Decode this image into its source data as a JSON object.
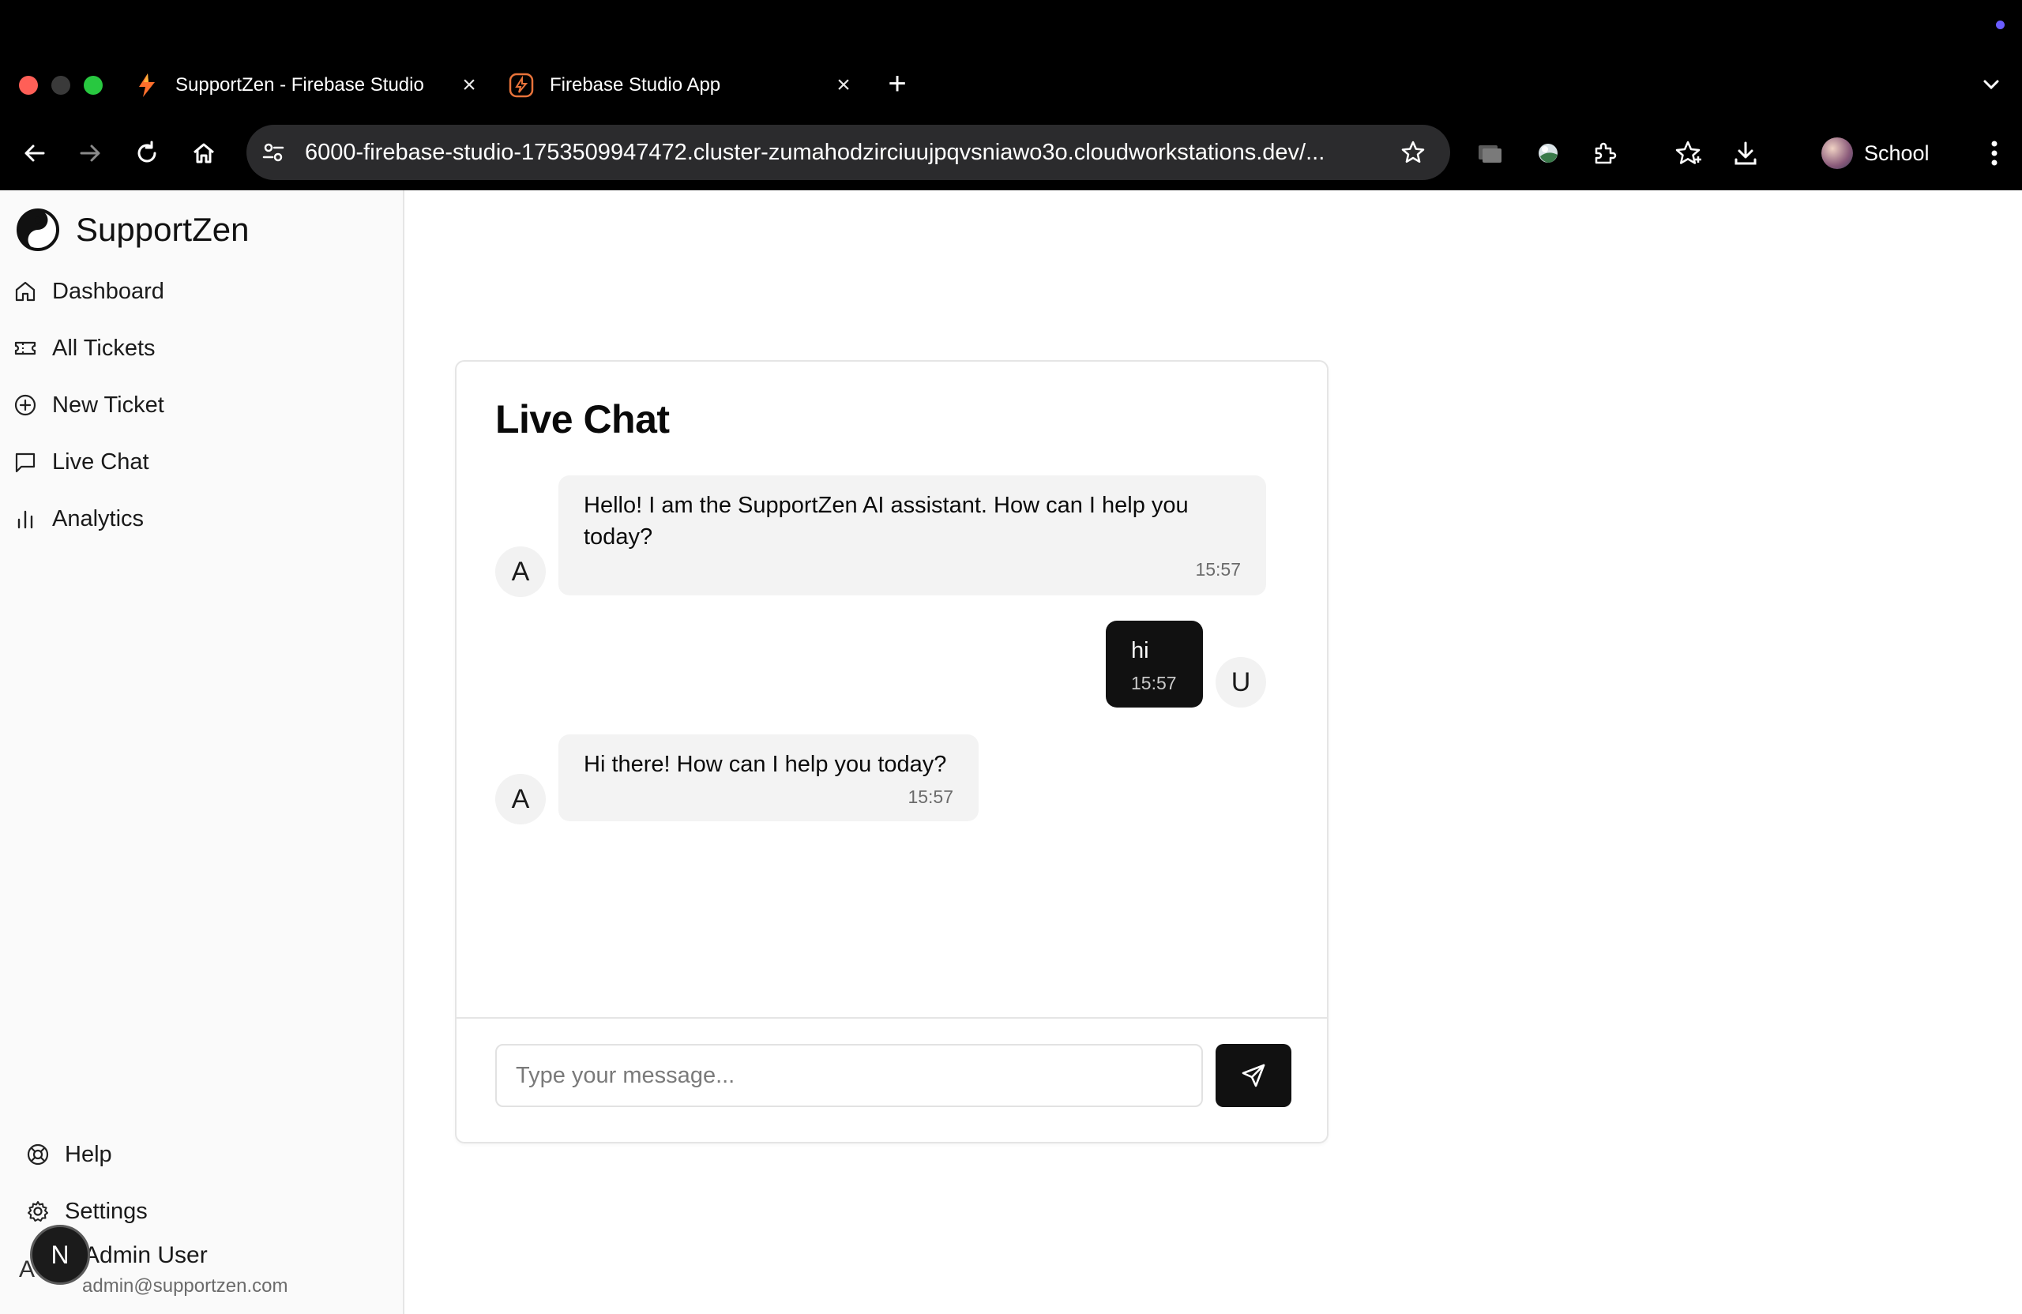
{
  "browser": {
    "tabs": [
      {
        "title": "SupportZen - Firebase Studio",
        "icon": "firebase-flame-icon"
      },
      {
        "title": "Firebase Studio App",
        "icon": "firebase-studio-icon"
      }
    ],
    "url": "6000-firebase-studio-1753509947472.cluster-zumahodzirciuujpqvsniawo3o.cloudworkstations.dev/...",
    "profile_label": "School"
  },
  "sidebar": {
    "brand": "SupportZen",
    "items": [
      {
        "label": "Dashboard",
        "icon": "home-icon"
      },
      {
        "label": "All Tickets",
        "icon": "ticket-icon"
      },
      {
        "label": "New Ticket",
        "icon": "plus-circle-icon"
      },
      {
        "label": "Live Chat",
        "icon": "message-square-icon"
      },
      {
        "label": "Analytics",
        "icon": "bar-chart-icon"
      }
    ],
    "footer": [
      {
        "label": "Help",
        "icon": "life-buoy-icon"
      },
      {
        "label": "Settings",
        "icon": "gear-icon"
      }
    ],
    "user": {
      "initial": "A",
      "name": "Admin User",
      "email": "admin@supportzen.com"
    },
    "overlay_badge": "N"
  },
  "chat": {
    "title": "Live Chat",
    "messages": [
      {
        "role": "assistant",
        "avatar": "A",
        "text": "Hello! I am the SupportZen AI assistant. How can I help you today?",
        "time": "15:57"
      },
      {
        "role": "user",
        "avatar": "U",
        "text": "hi",
        "time": "15:57"
      },
      {
        "role": "assistant",
        "avatar": "A",
        "text": "Hi there! How can I help you today?",
        "time": "15:57"
      }
    ],
    "input": {
      "placeholder": "Type your message...",
      "value": ""
    }
  }
}
